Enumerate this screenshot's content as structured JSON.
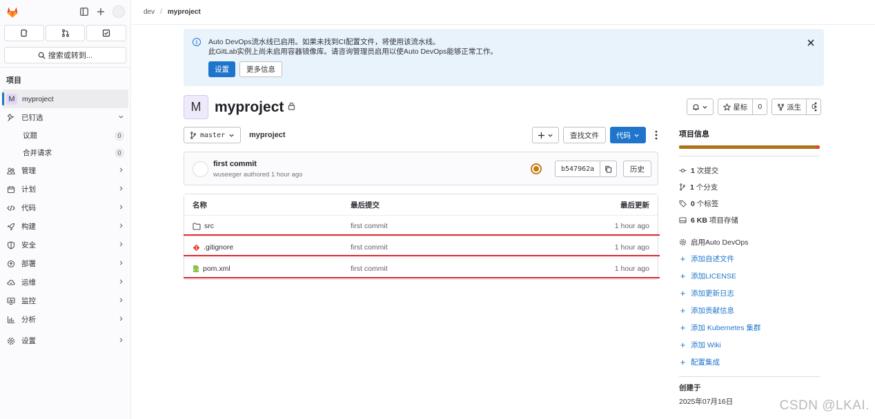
{
  "sidebar": {
    "search_label": "搜索或转到...",
    "section_title": "项目",
    "project": {
      "badge": "M",
      "name": "myproject"
    },
    "pinned": {
      "label": "已钉选",
      "items": [
        {
          "label": "议题",
          "count": "0"
        },
        {
          "label": "合并请求",
          "count": "0"
        }
      ]
    },
    "nav": [
      {
        "label": "管理",
        "icon": "users-icon"
      },
      {
        "label": "计划",
        "icon": "calendar-icon"
      },
      {
        "label": "代码",
        "icon": "code-icon"
      },
      {
        "label": "构建",
        "icon": "rocket-icon"
      },
      {
        "label": "安全",
        "icon": "shield-icon"
      },
      {
        "label": "部署",
        "icon": "deploy-icon"
      },
      {
        "label": "运维",
        "icon": "cloud-gear-icon"
      },
      {
        "label": "监控",
        "icon": "monitor-icon"
      },
      {
        "label": "分析",
        "icon": "chart-icon"
      },
      {
        "label": "设置",
        "icon": "gear-icon"
      }
    ]
  },
  "breadcrumb": {
    "group": "dev",
    "project": "myproject"
  },
  "alert": {
    "line1": "Auto DevOps流水线已启用。如果未找到CI配置文件，将使用该流水线。",
    "line2": "此GitLab实例上尚未启用容器镜像库。请咨询管理员启用以使Auto DevOps能够正常工作。",
    "primary_button": "设置",
    "secondary_button": "更多信息"
  },
  "project": {
    "badge": "M",
    "title": "myproject",
    "star_label": "星标",
    "star_count": "0",
    "fork_label": "派生",
    "fork_count": "0"
  },
  "repo": {
    "branch": "master",
    "path": "myproject",
    "find_file": "查找文件",
    "code_button": "代码"
  },
  "commit": {
    "message": "first commit",
    "meta": "wuseeger authored 1 hour ago",
    "sha": "b547962a",
    "history": "历史"
  },
  "files": {
    "headers": {
      "name": "名称",
      "last_commit": "最后提交",
      "last_update": "最后更新"
    },
    "rows": [
      {
        "name": "src",
        "commit": "first commit",
        "updated": "1 hour ago"
      },
      {
        "name": ".gitignore",
        "commit": "first commit",
        "updated": "1 hour ago"
      },
      {
        "name": "pom.xml",
        "commit": "first commit",
        "updated": "1 hour ago"
      }
    ]
  },
  "info": {
    "title": "项目信息",
    "commits": {
      "num": "1",
      "label": "次提交"
    },
    "branches": {
      "num": "1",
      "label": "个分支"
    },
    "tags": {
      "num": "0",
      "label": "个标签"
    },
    "storage": {
      "num": "6 KB",
      "label": "项目存储"
    },
    "auto_devops": "启用Auto DevOps",
    "links": [
      "添加自述文件",
      "添加LICENSE",
      "添加更新日志",
      "添加贡献信息",
      "添加 Kubernetes 集群",
      "添加 Wiki",
      "配置集成"
    ],
    "created_label": "创建于",
    "created_date": "2025年07月16日",
    "language_colors": [
      "#b07219",
      "#e44b23"
    ],
    "language_shares": [
      0.97,
      0.03
    ]
  },
  "colors": {
    "accent": "#1f75cb",
    "highlight": "#d9262f",
    "pipeline": "#c17d10"
  },
  "watermark": "CSDN @LKAI."
}
